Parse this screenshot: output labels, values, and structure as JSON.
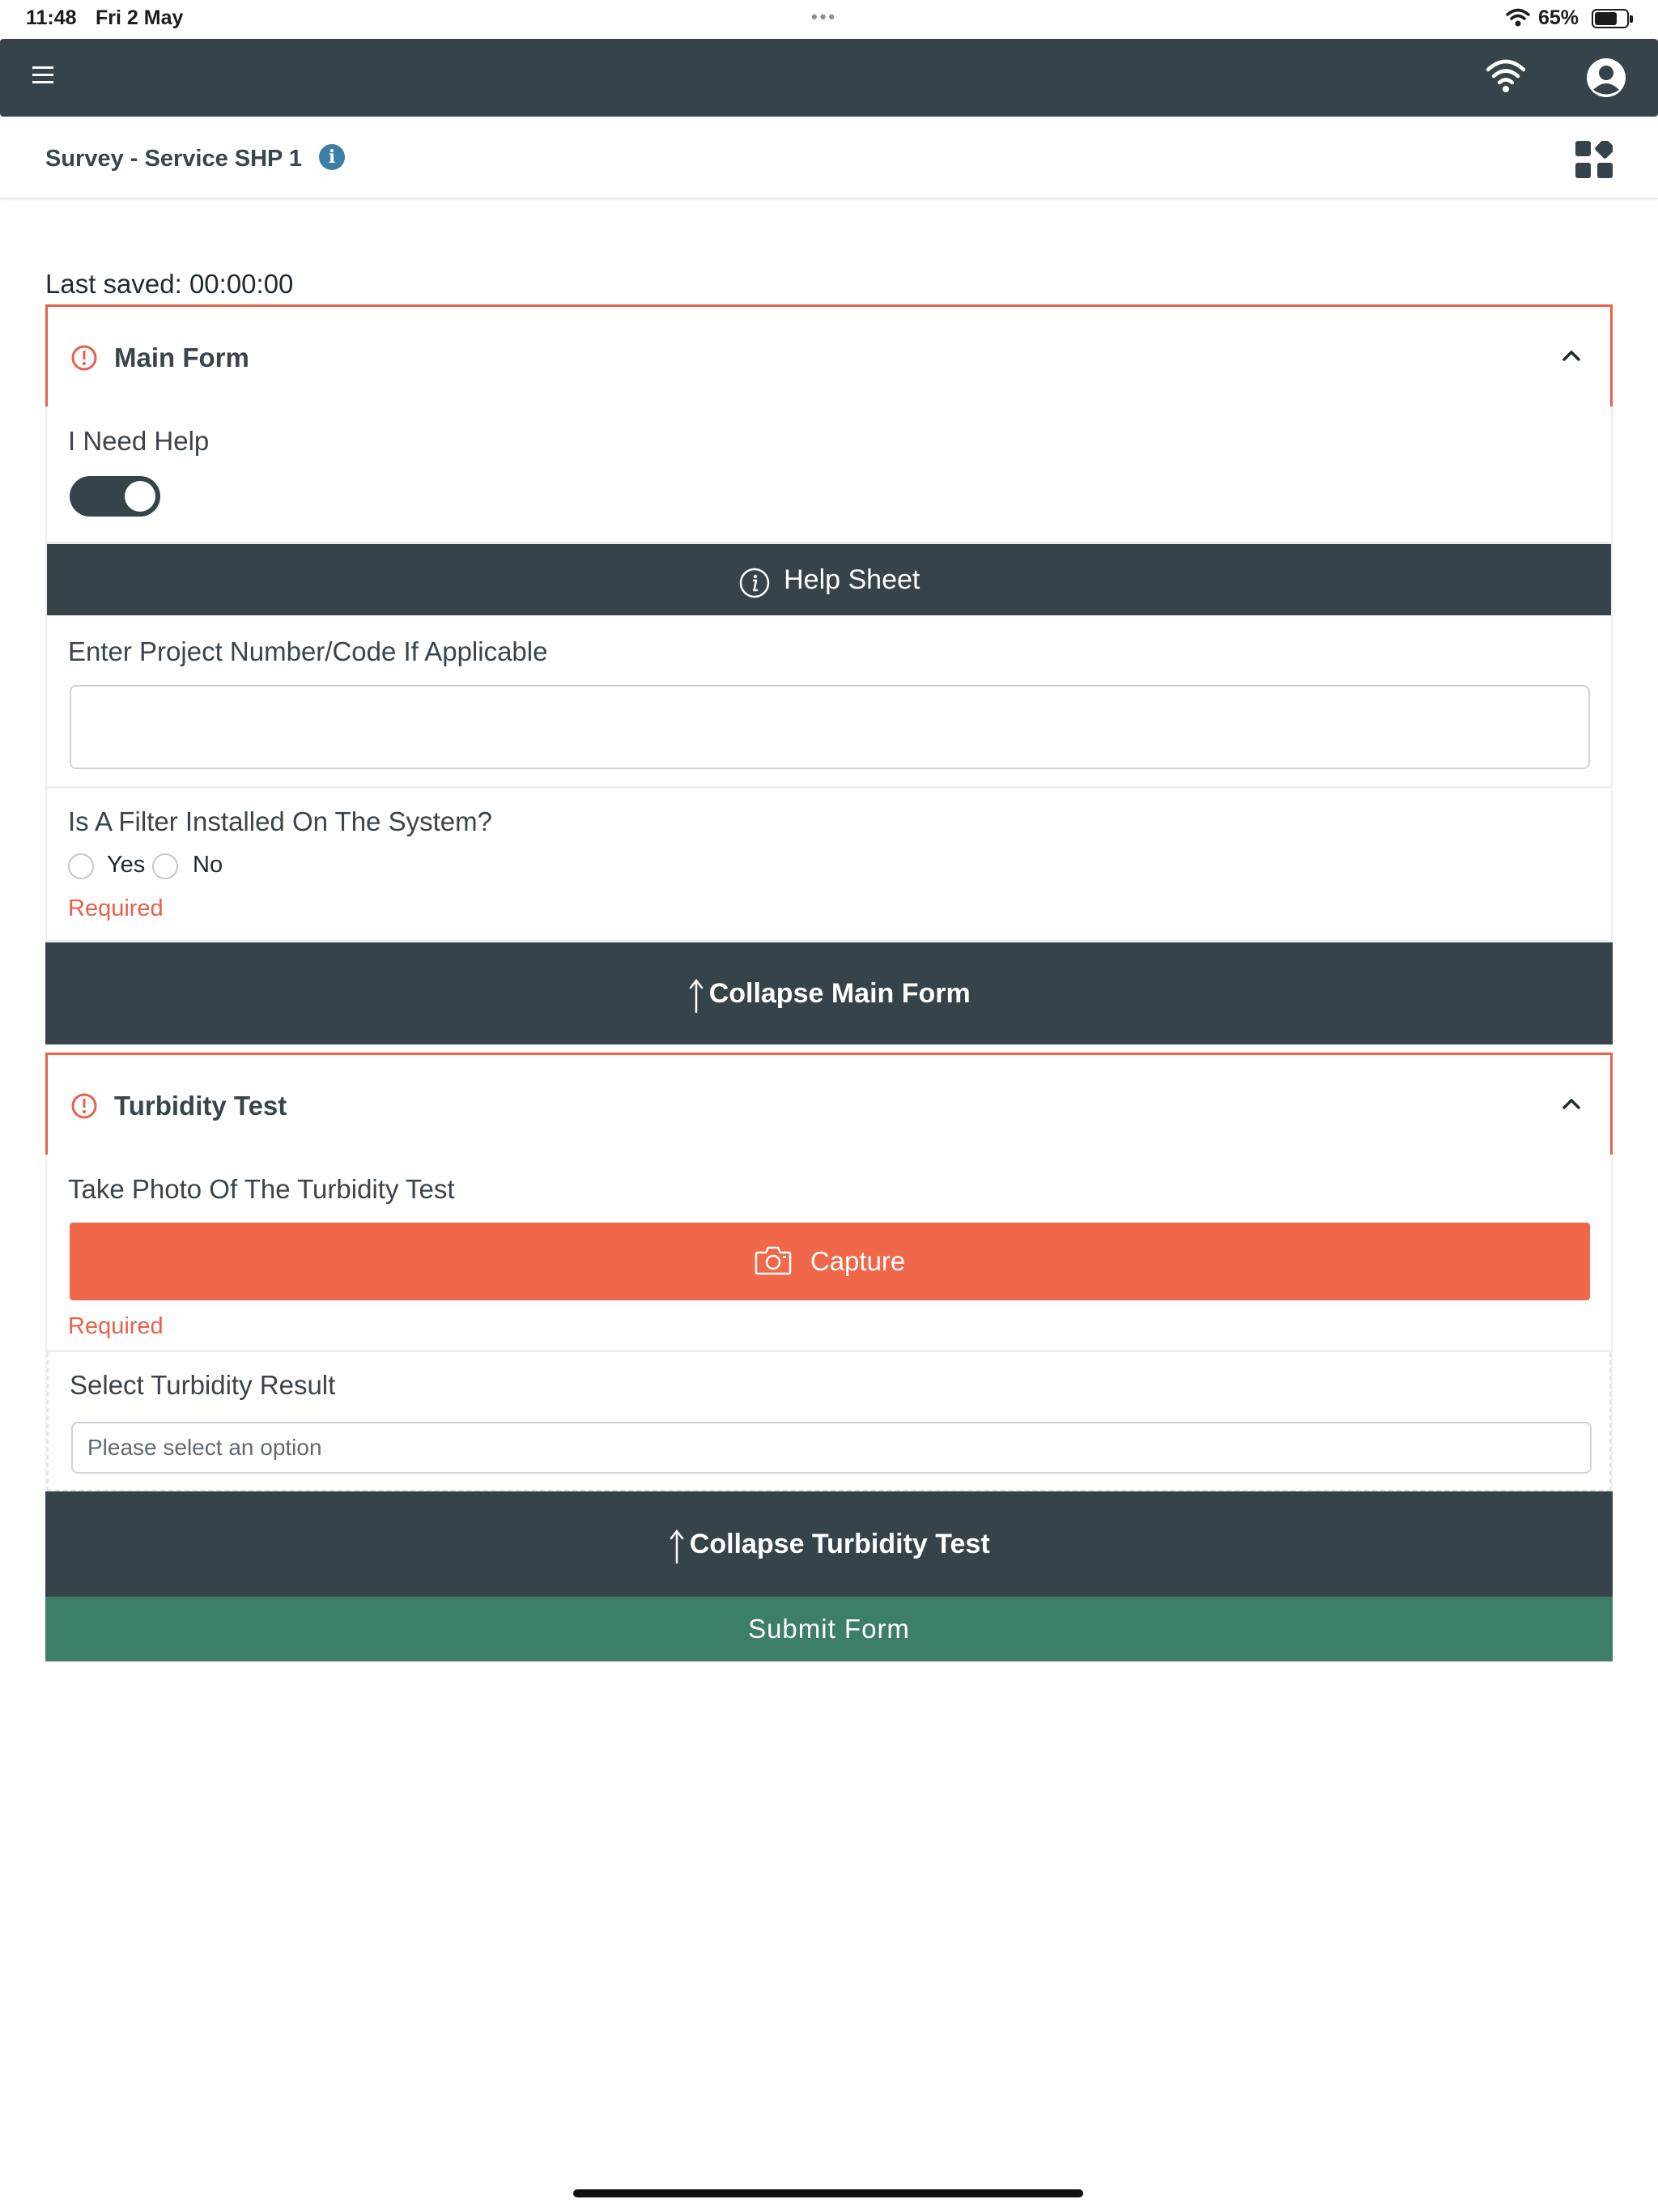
{
  "status_bar": {
    "time": "11:48",
    "date": "Fri 2 May",
    "battery_pct": "65%"
  },
  "header": {
    "title": "Survey - Service SHP 1"
  },
  "last_saved": "Last saved: 00:00:00",
  "main_form": {
    "title": "Main Form",
    "need_help_label": "I Need Help",
    "help_sheet_label": "Help Sheet",
    "project_label": "Enter Project Number/Code If Applicable",
    "project_value": "",
    "filter_label": "Is A Filter Installed On The System?",
    "option_yes": "Yes",
    "option_no": "No",
    "required_text": "Required",
    "collapse_label": "Collapse Main Form"
  },
  "turbidity_test": {
    "title": "Turbidity Test",
    "photo_label": "Take Photo Of The Turbidity Test",
    "capture_label": "Capture",
    "required_text": "Required",
    "result_label": "Select Turbidity Result",
    "result_placeholder": "Please select an option",
    "collapse_label": "Collapse Turbidity Test"
  },
  "submit_label": "Submit Form",
  "colors": {
    "dark": "#37434b",
    "accent": "#f06749",
    "submit": "#3d7e6b",
    "info": "#3d7ea6"
  }
}
